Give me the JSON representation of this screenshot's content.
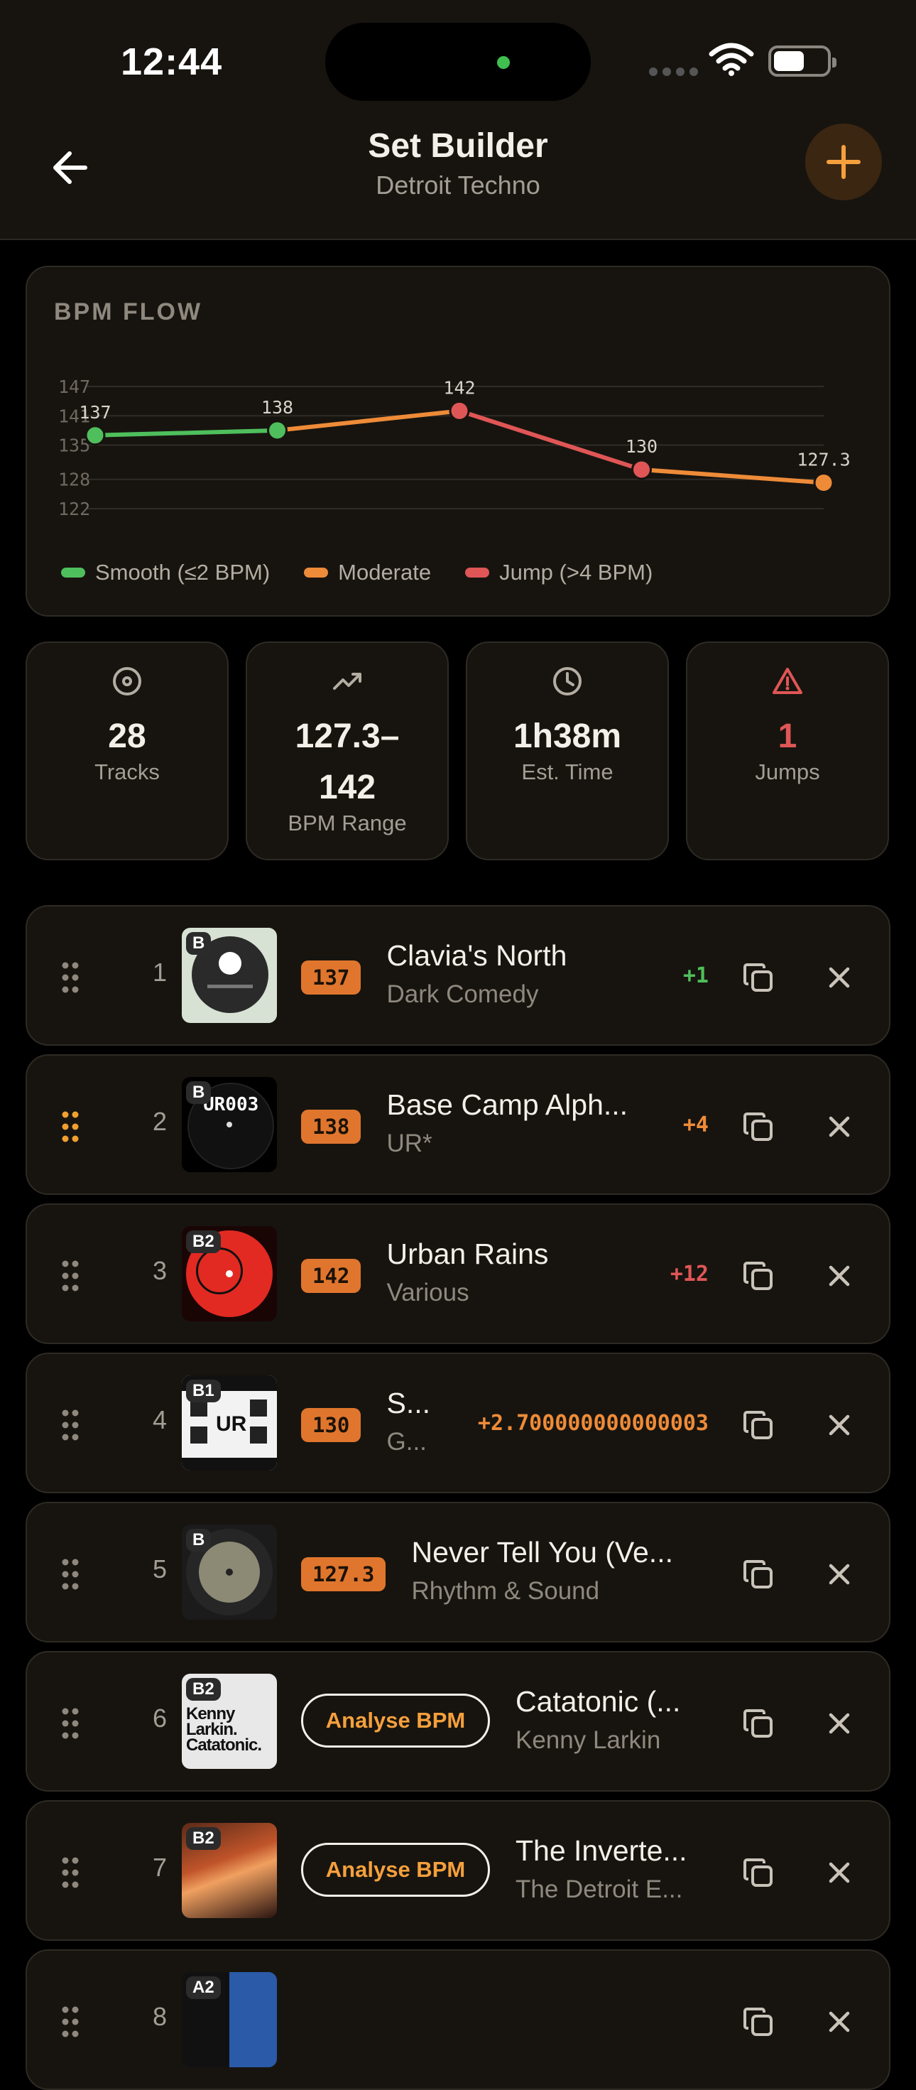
{
  "status": {
    "time": "12:44"
  },
  "header": {
    "title": "Set Builder",
    "subtitle": "Detroit Techno"
  },
  "chart": {
    "label": "BPM FLOW",
    "legend": [
      {
        "label": "Smooth (≤2 BPM)",
        "color": "#4ebf5c"
      },
      {
        "label": "Moderate",
        "color": "#ee8b38"
      },
      {
        "label": "Jump (>4 BPM)",
        "color": "#e05656"
      }
    ]
  },
  "chart_data": {
    "type": "line",
    "title": "BPM FLOW",
    "x": [
      1,
      2,
      3,
      4,
      5
    ],
    "values": [
      137,
      138,
      142,
      130,
      127.3
    ],
    "point_labels": [
      "137",
      "138",
      "142",
      "130",
      "127.3"
    ],
    "point_colors": [
      "#4ebf5c",
      "#4ebf5c",
      "#e05656",
      "#e05656",
      "#ee8b38"
    ],
    "segment_colors": [
      "#4ebf5c",
      "#ee8b38",
      "#e05656",
      "#ee8b38"
    ],
    "yticks": [
      147,
      141,
      135,
      128,
      122
    ],
    "ylim": [
      122,
      147
    ],
    "grid": true
  },
  "stats": [
    {
      "icon": "disc-icon",
      "value": "28",
      "label": "Tracks"
    },
    {
      "icon": "trending-up-icon",
      "value": "127.3–\n142",
      "label": "BPM Range"
    },
    {
      "icon": "clock-icon",
      "value": "1h38m",
      "label": "Est. Time"
    },
    {
      "icon": "warning-icon",
      "value": "1",
      "label": "Jumps",
      "color": "#e05656"
    }
  ],
  "tracks": [
    {
      "num": "1",
      "side": "B",
      "bpm": "137",
      "title": "Clavia's North",
      "artist": "Dark Comedy",
      "delta": "+1",
      "delta_color": "#4ebf5c"
    },
    {
      "num": "2",
      "side": "B",
      "bpm": "138",
      "title": "Base Camp Alph...",
      "artist": "UR*",
      "delta": "+4",
      "delta_color": "#ee8b38",
      "drag_color": "#f0a030"
    },
    {
      "num": "3",
      "side": "B2",
      "bpm": "142",
      "title": "Urban Rains",
      "artist": "Various",
      "delta": "+12",
      "delta_color": "#e05656"
    },
    {
      "num": "4",
      "side": "B1",
      "bpm": "130",
      "title": "S...",
      "artist": "G...",
      "delta": "+2.700000000000003",
      "delta_color": "#ee8b38"
    },
    {
      "num": "5",
      "side": "B",
      "bpm": "127.3",
      "title": "Never Tell You (Ve...",
      "artist": "Rhythm & Sound",
      "delta": ""
    },
    {
      "num": "6",
      "side": "B2",
      "analyse": "Analyse BPM",
      "title": "Catatonic (...",
      "artist": "Kenny Larkin",
      "delta": ""
    },
    {
      "num": "7",
      "side": "B2",
      "analyse": "Analyse BPM",
      "title": "The Inverte...",
      "artist": "The Detroit E...",
      "delta": ""
    },
    {
      "num": "8",
      "side": "A2",
      "title": "",
      "artist": "",
      "delta": ""
    }
  ]
}
